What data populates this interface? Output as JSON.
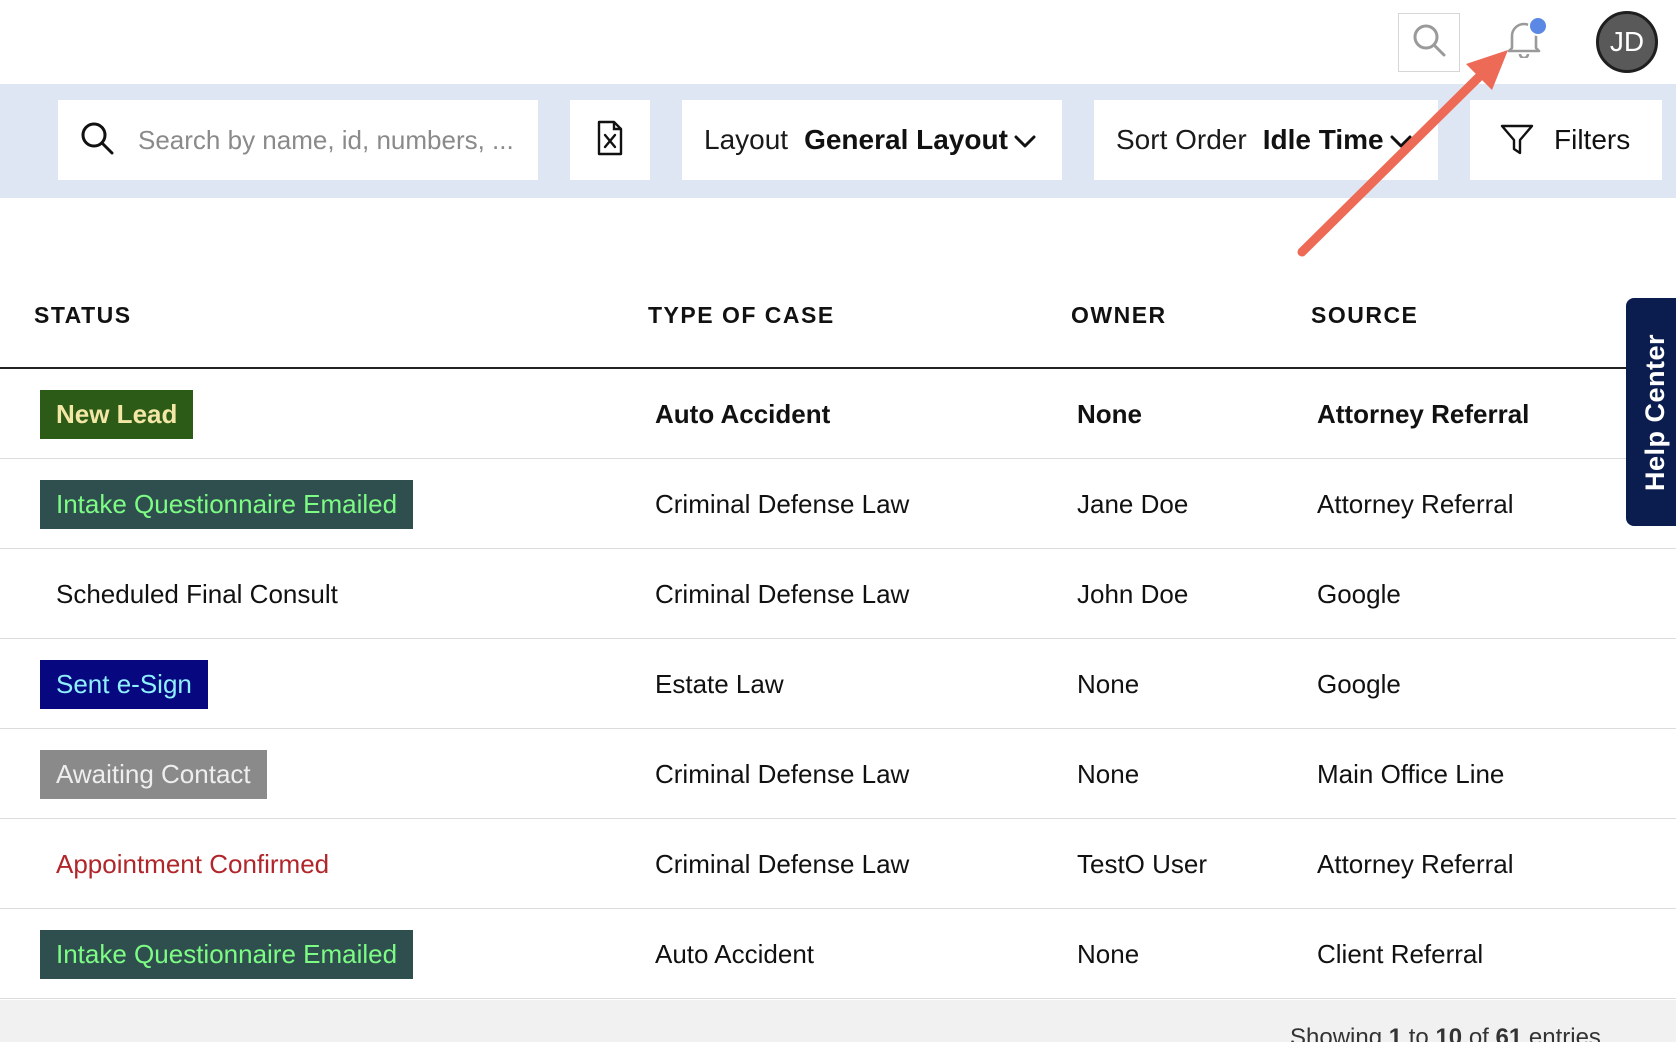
{
  "header": {
    "avatar_initials": "JD",
    "notification_dot_color": "#5b87e5"
  },
  "toolbar": {
    "search_placeholder": "Search by name, id, numbers, ...",
    "layout_label": "Layout",
    "layout_value": "General Layout",
    "sort_label": "Sort Order",
    "sort_value": "Idle Time",
    "filters_label": "Filters"
  },
  "table": {
    "columns": [
      "STATUS",
      "TYPE OF CASE",
      "OWNER",
      "SOURCE"
    ],
    "rows": [
      {
        "status": "New Lead",
        "status_bg": "#2c5a17",
        "status_fg": "#f3e7a6",
        "type": "Auto Accident",
        "owner": "None",
        "source": "Attorney Referral",
        "bold": true
      },
      {
        "status": "Intake Questionnaire Emailed",
        "status_bg": "#2f4f4f",
        "status_fg": "#7dfc84",
        "type": "Criminal Defense Law",
        "owner": "Jane Doe",
        "source": "Attorney Referral",
        "bold": false
      },
      {
        "status": "Scheduled Final Consult",
        "status_bg": "",
        "status_fg": "#111111",
        "type": "Criminal Defense Law",
        "owner": "John Doe",
        "source": "Google",
        "bold": false
      },
      {
        "status": "Sent e-Sign",
        "status_bg": "#07077f",
        "status_fg": "#8ff0ff",
        "type": "Estate Law",
        "owner": "None",
        "source": "Google",
        "bold": false
      },
      {
        "status": "Awaiting Contact",
        "status_bg": "#8a8a8a",
        "status_fg": "#eeeeee",
        "type": "Criminal Defense Law",
        "owner": "None",
        "source": "Main Office Line",
        "bold": false
      },
      {
        "status": "Appointment Confirmed",
        "status_bg": "",
        "status_fg": "#b0262a",
        "type": "Criminal Defense Law",
        "owner": "TestO User",
        "source": "Attorney Referral",
        "bold": false
      },
      {
        "status": "Intake Questionnaire Emailed",
        "status_bg": "#2f4f4f",
        "status_fg": "#7dfc84",
        "type": "Auto Accident",
        "owner": "None",
        "source": "Client Referral",
        "bold": false
      }
    ]
  },
  "footer": {
    "prefix": "Showing ",
    "from": "1",
    "mid1": " to ",
    "to": "10",
    "mid2": " of ",
    "total": "61",
    "suffix": " entries"
  },
  "help_center": {
    "label": "Help Center"
  },
  "annotation": {
    "arrow_color": "#ec6a56"
  }
}
